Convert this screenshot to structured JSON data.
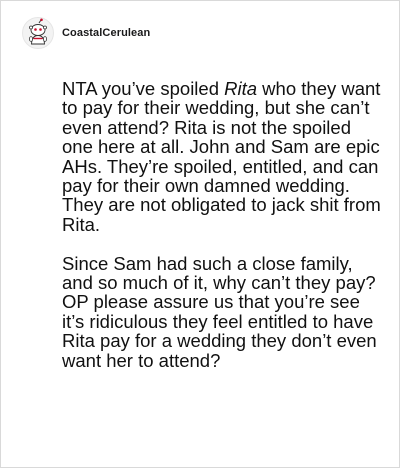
{
  "comment": {
    "username": "CoastalCerulean",
    "avatar_icon": "snoo-avatar-icon",
    "paragraph1": {
      "before": "NTA you’ve spoiled ",
      "italic": "Rita",
      "after": " who they want to pay for their wedding, but she can’t even attend? Rita is not the spoiled one here at all. John and Sam are epic AHs. They’re spoiled, entitled, and can pay for their own damned wedding. They are not obligated to jack shit from Rita."
    },
    "paragraph2": "Since Sam had such a close family, and so much of it, why can’t they pay? OP please assure us that you’re see it’s ridiculous they feel entitled to have Rita pay for a wedding they don’t even want her to attend?"
  },
  "colors": {
    "text": "#111111",
    "border": "#d9d9d9",
    "avatar_accent": "#c8102e"
  }
}
